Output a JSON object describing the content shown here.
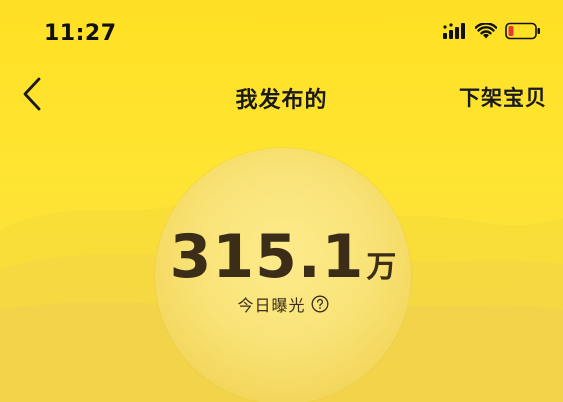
{
  "status_bar": {
    "time": "11:27"
  },
  "nav": {
    "title": "我发布的",
    "action_label": "下架宝贝"
  },
  "exposure": {
    "value": "315.1",
    "unit": "万",
    "label": "今日曝光"
  },
  "colors": {
    "background": "#FFE22D",
    "circle": "#F9E377",
    "text_dark": "#3b2d18",
    "battery_low": "#E53935"
  },
  "icons": {
    "back": "chevron-left-icon",
    "signal": "signal-icon",
    "wifi": "wifi-icon",
    "battery": "battery-icon",
    "help": "question-circle-icon"
  }
}
